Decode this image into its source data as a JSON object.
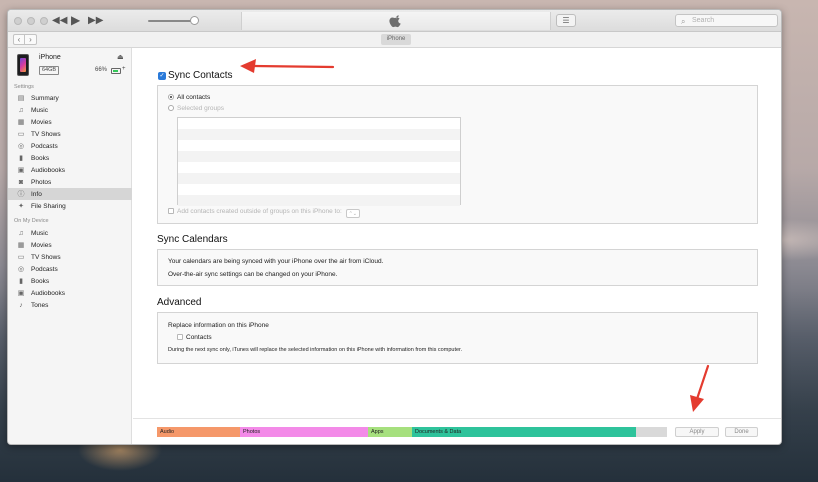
{
  "window": {
    "search_placeholder": "Search",
    "device_pill": "iPhone"
  },
  "device": {
    "name": "iPhone",
    "capacity": "64GB",
    "battery_percent": "66%",
    "battery_level": 0.66
  },
  "sidebar": {
    "settings_header": "Settings",
    "settings_items": [
      {
        "label": "Summary",
        "icon": "summary-icon",
        "glyph": "▤"
      },
      {
        "label": "Music",
        "icon": "music-note-icon",
        "glyph": "♫"
      },
      {
        "label": "Movies",
        "icon": "film-icon",
        "glyph": "▦"
      },
      {
        "label": "TV Shows",
        "icon": "tv-icon",
        "glyph": "▭"
      },
      {
        "label": "Podcasts",
        "icon": "podcast-icon",
        "glyph": "◎"
      },
      {
        "label": "Books",
        "icon": "book-icon",
        "glyph": "▮"
      },
      {
        "label": "Audiobooks",
        "icon": "audiobook-icon",
        "glyph": "▣"
      },
      {
        "label": "Photos",
        "icon": "camera-icon",
        "glyph": "◙"
      },
      {
        "label": "Info",
        "icon": "info-icon",
        "glyph": "ⓘ",
        "active": true
      },
      {
        "label": "File Sharing",
        "icon": "file-sharing-icon",
        "glyph": "✦"
      }
    ],
    "device_header": "On My Device",
    "device_items": [
      {
        "label": "Music",
        "icon": "music-note-icon",
        "glyph": "♫"
      },
      {
        "label": "Movies",
        "icon": "film-icon",
        "glyph": "▦"
      },
      {
        "label": "TV Shows",
        "icon": "tv-icon",
        "glyph": "▭"
      },
      {
        "label": "Podcasts",
        "icon": "podcast-icon",
        "glyph": "◎"
      },
      {
        "label": "Books",
        "icon": "book-icon",
        "glyph": "▮"
      },
      {
        "label": "Audiobooks",
        "icon": "audiobook-icon",
        "glyph": "▣"
      },
      {
        "label": "Tones",
        "icon": "bell-icon",
        "glyph": "♪"
      }
    ]
  },
  "contacts": {
    "title": "Sync Contacts",
    "all_contacts": "All contacts",
    "selected_groups": "Selected groups",
    "add_outside": "Add contacts created outside of groups on this iPhone to:"
  },
  "calendars": {
    "title": "Sync Calendars",
    "line1": "Your calendars are being synced with your iPhone over the air from iCloud.",
    "line2": "Over-the-air sync settings can be changed on your iPhone."
  },
  "advanced": {
    "title": "Advanced",
    "replace": "Replace information on this iPhone",
    "contacts": "Contacts",
    "note": "During the next sync only, iTunes will replace the selected information on this iPhone with information from this computer."
  },
  "storage": {
    "segments": [
      {
        "label": "Audio",
        "color": "#f5986a",
        "fraction": 0.163
      },
      {
        "label": "Photos",
        "color": "#f38ae8",
        "fraction": 0.25
      },
      {
        "label": "Apps",
        "color": "#a6e07e",
        "fraction": 0.086
      },
      {
        "label": "Documents & Data",
        "color": "#2ec39b",
        "fraction": 0.44
      },
      {
        "label": "",
        "color": "#d9d9d9",
        "fraction": 0.061
      }
    ]
  },
  "buttons": {
    "apply": "Apply",
    "done": "Done"
  },
  "colors": {
    "annotation_arrow": "#e43b2f",
    "checkbox_blue": "#2a7ad9"
  }
}
